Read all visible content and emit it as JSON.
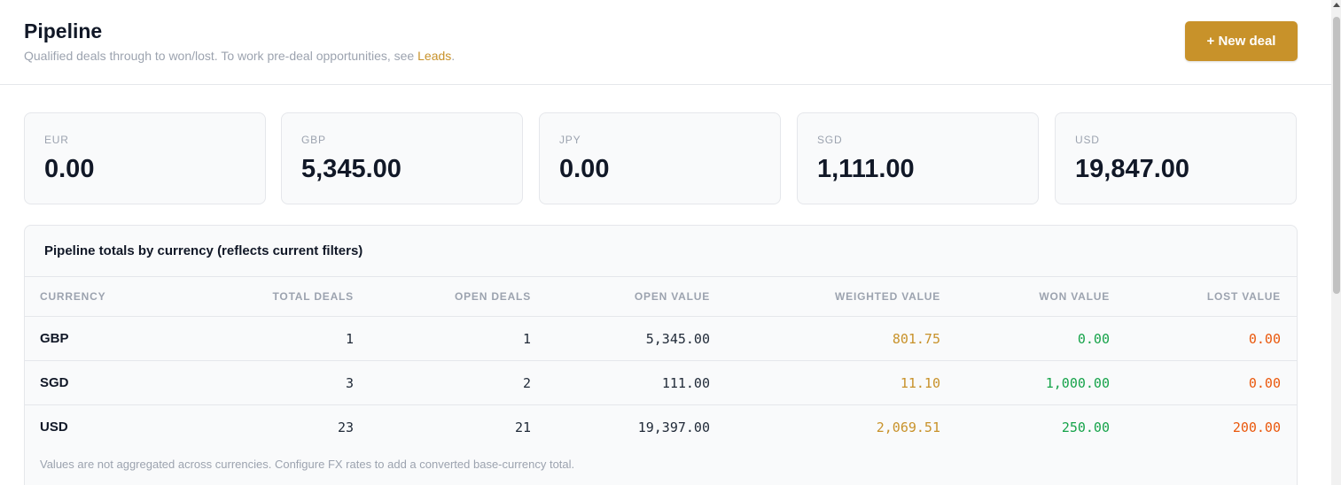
{
  "header": {
    "title": "Pipeline",
    "subtitle_text": "Qualified deals through to won/lost. To work pre-deal opportunities, see ",
    "subtitle_link": "Leads",
    "subtitle_end": ".",
    "new_deal_label": "+ New deal"
  },
  "cards": [
    {
      "currency": "EUR",
      "value": "0.00"
    },
    {
      "currency": "GBP",
      "value": "5,345.00"
    },
    {
      "currency": "JPY",
      "value": "0.00"
    },
    {
      "currency": "SGD",
      "value": "1,111.00"
    },
    {
      "currency": "USD",
      "value": "19,847.00"
    }
  ],
  "totals": {
    "title": "Pipeline totals by currency (reflects current filters)",
    "columns": [
      "CURRENCY",
      "TOTAL DEALS",
      "OPEN DEALS",
      "OPEN VALUE",
      "WEIGHTED VALUE",
      "WON VALUE",
      "LOST VALUE"
    ],
    "rows": [
      [
        "GBP",
        "1",
        "1",
        "5,345.00",
        "801.75",
        "0.00",
        "0.00"
      ],
      [
        "SGD",
        "3",
        "2",
        "111.00",
        "11.10",
        "1,000.00",
        "0.00"
      ],
      [
        "USD",
        "23",
        "21",
        "19,397.00",
        "2,069.51",
        "250.00",
        "200.00"
      ]
    ],
    "footnote": "Values are not aggregated across currencies. Configure FX rates to add a converted base-currency total."
  },
  "colors": {
    "accent": "#c8922a",
    "won": "#16a34a",
    "lost": "#ea580c"
  }
}
